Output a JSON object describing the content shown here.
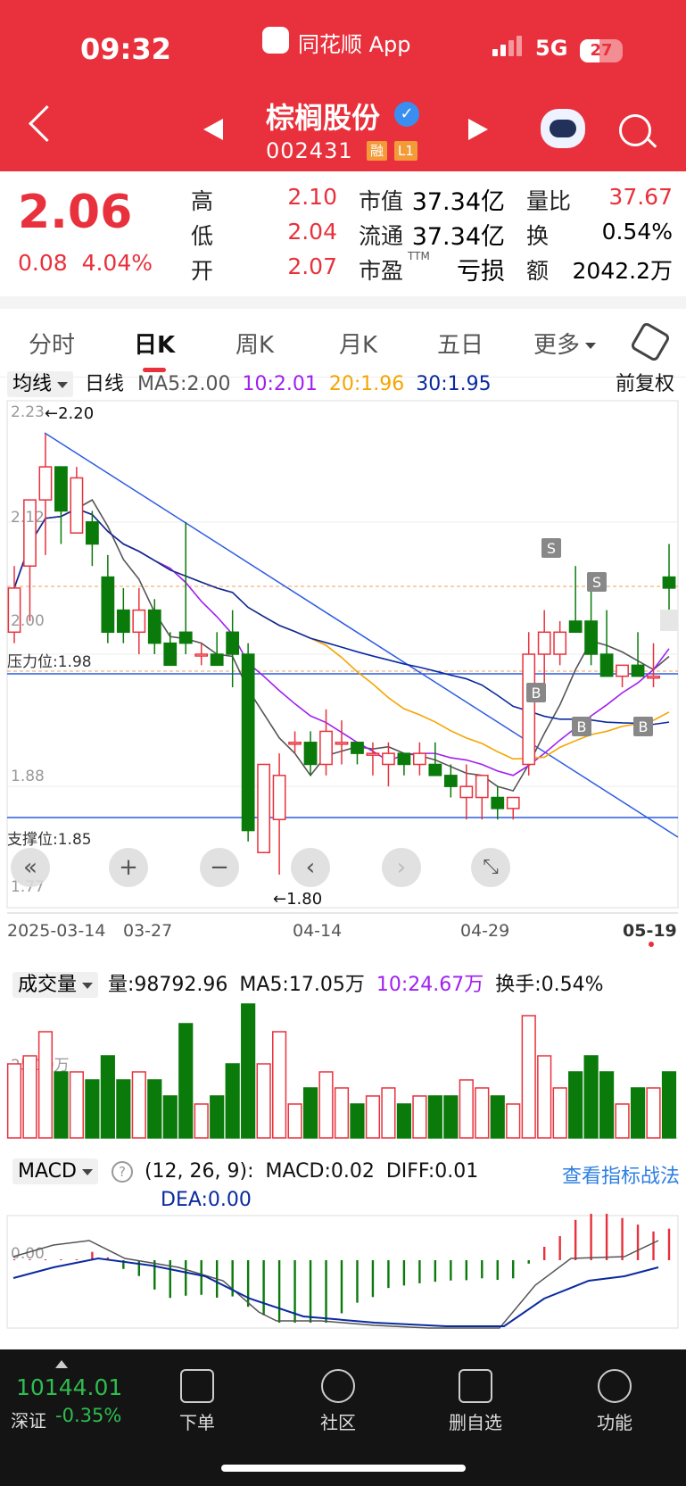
{
  "status_bar": {
    "time": "09:32",
    "app": "同花顺 App",
    "network": "5G",
    "battery": "27"
  },
  "header": {
    "stock_name": "棕榈股份",
    "code": "002431",
    "tag_margin": "融",
    "tag_level": "L1"
  },
  "quote": {
    "price": "2.06",
    "change": "0.08",
    "change_pct": "4.04%",
    "high_label": "高",
    "high": "2.10",
    "low_label": "低",
    "low": "2.04",
    "open_label": "开",
    "open": "2.07",
    "mktcap_label": "市值",
    "mktcap": "37.34亿",
    "float_label": "流通",
    "float": "37.34亿",
    "pe_label": "市盈",
    "pe_sup": "TTM",
    "pe": "亏损",
    "volratio_label": "量比",
    "volratio": "37.67",
    "turnover_label": "换",
    "turnover": "0.54%",
    "amount_label": "额",
    "amount": "2042.2万"
  },
  "tabs": [
    "分时",
    "日K",
    "周K",
    "月K",
    "五日",
    "更多"
  ],
  "ma_legend": {
    "selector": "均线",
    "period": "日线",
    "ma5": "MA5:2.00",
    "ma10": "10:2.01",
    "ma20": "20:1.96",
    "ma30": "30:1.95",
    "adjust": "前复权"
  },
  "kchart_labels": {
    "y_top": "2.23",
    "y_212": "2.12",
    "y_200": "2.00",
    "y_188": "1.88",
    "y_177": "1.77",
    "max_marker": "←2.20",
    "min_marker": "←1.80",
    "resistance": "压力位:1.98",
    "support": "支撑位:1.85",
    "dates": [
      "2025-03-14",
      "03-27",
      "04-14",
      "04-29",
      "05-19"
    ]
  },
  "chart_data": {
    "type": "candlestick",
    "ylim": [
      1.77,
      2.23
    ],
    "candles": [
      {
        "o": 2.02,
        "h": 2.08,
        "l": 2.01,
        "c": 2.06
      },
      {
        "o": 2.08,
        "h": 2.11,
        "l": 2.03,
        "c": 2.14
      },
      {
        "o": 2.14,
        "h": 2.2,
        "l": 2.09,
        "c": 2.17
      },
      {
        "o": 2.17,
        "h": 2.16,
        "l": 2.1,
        "c": 2.13
      },
      {
        "o": 2.11,
        "h": 2.17,
        "l": 2.11,
        "c": 2.16
      },
      {
        "o": 2.12,
        "h": 2.13,
        "l": 2.08,
        "c": 2.1
      },
      {
        "o": 2.07,
        "h": 2.09,
        "l": 2.01,
        "c": 2.02
      },
      {
        "o": 2.04,
        "h": 2.06,
        "l": 2.01,
        "c": 2.02
      },
      {
        "o": 2.02,
        "h": 2.06,
        "l": 2.0,
        "c": 2.04
      },
      {
        "o": 2.04,
        "h": 2.05,
        "l": 2.0,
        "c": 2.01
      },
      {
        "o": 2.01,
        "h": 2.02,
        "l": 1.99,
        "c": 1.99
      },
      {
        "o": 2.02,
        "h": 2.12,
        "l": 2.0,
        "c": 2.01
      },
      {
        "o": 2.0,
        "h": 2.01,
        "l": 1.99,
        "c": 2.0
      },
      {
        "o": 2.0,
        "h": 2.02,
        "l": 1.99,
        "c": 1.99
      },
      {
        "o": 2.02,
        "h": 2.04,
        "l": 1.97,
        "c": 2.0
      },
      {
        "o": 2.0,
        "h": 2.01,
        "l": 1.83,
        "c": 1.84
      },
      {
        "o": 1.82,
        "h": 1.89,
        "l": 1.82,
        "c": 1.9
      },
      {
        "o": 1.85,
        "h": 1.91,
        "l": 1.8,
        "c": 1.89
      },
      {
        "o": 1.92,
        "h": 1.93,
        "l": 1.91,
        "c": 1.92
      },
      {
        "o": 1.92,
        "h": 1.93,
        "l": 1.89,
        "c": 1.9
      },
      {
        "o": 1.9,
        "h": 1.95,
        "l": 1.89,
        "c": 1.93
      },
      {
        "o": 1.92,
        "h": 1.94,
        "l": 1.9,
        "c": 1.92
      },
      {
        "o": 1.92,
        "h": 1.92,
        "l": 1.9,
        "c": 1.91
      },
      {
        "o": 1.91,
        "h": 1.92,
        "l": 1.89,
        "c": 1.91
      },
      {
        "o": 1.9,
        "h": 1.92,
        "l": 1.88,
        "c": 1.91
      },
      {
        "o": 1.91,
        "h": 1.91,
        "l": 1.89,
        "c": 1.9
      },
      {
        "o": 1.9,
        "h": 1.92,
        "l": 1.89,
        "c": 1.91
      },
      {
        "o": 1.9,
        "h": 1.92,
        "l": 1.89,
        "c": 1.89
      },
      {
        "o": 1.89,
        "h": 1.9,
        "l": 1.87,
        "c": 1.88
      },
      {
        "o": 1.87,
        "h": 1.9,
        "l": 1.85,
        "c": 1.88
      },
      {
        "o": 1.87,
        "h": 1.89,
        "l": 1.85,
        "c": 1.89
      },
      {
        "o": 1.87,
        "h": 1.88,
        "l": 1.85,
        "c": 1.86
      },
      {
        "o": 1.86,
        "h": 1.87,
        "l": 1.85,
        "c": 1.87
      },
      {
        "o": 1.9,
        "h": 2.02,
        "l": 1.89,
        "c": 2.0
      },
      {
        "o": 2.0,
        "h": 2.04,
        "l": 1.96,
        "c": 2.02
      },
      {
        "o": 2.0,
        "h": 2.03,
        "l": 1.99,
        "c": 2.02
      },
      {
        "o": 2.03,
        "h": 2.08,
        "l": 2.02,
        "c": 2.02
      },
      {
        "o": 2.03,
        "h": 2.07,
        "l": 1.99,
        "c": 2.0
      },
      {
        "o": 2.0,
        "h": 2.04,
        "l": 1.98,
        "c": 1.98
      },
      {
        "o": 1.98,
        "h": 1.99,
        "l": 1.97,
        "c": 1.99
      },
      {
        "o": 1.99,
        "h": 2.02,
        "l": 1.98,
        "c": 1.98
      },
      {
        "o": 1.98,
        "h": 2.01,
        "l": 1.97,
        "c": 1.98
      },
      {
        "o": 2.07,
        "h": 2.1,
        "l": 2.04,
        "c": 2.06
      }
    ],
    "volume_axis_label": "25.19万",
    "macd_axis_label": "0.00"
  },
  "volume_legend": {
    "selector": "成交量",
    "vol": "量:98792.96",
    "ma5": "MA5:17.05万",
    "ma10": "10:24.67万",
    "turnover": "换手:0.54%"
  },
  "macd_legend": {
    "selector": "MACD",
    "params": "(12, 26, 9):",
    "macd": "MACD:0.02",
    "diff": "DIFF:0.01",
    "dea": "DEA:0.00",
    "link": "查看指标战法"
  },
  "bottom": {
    "index_value": "10144.01",
    "index_name": "深证",
    "index_change": "-0.35%",
    "items": [
      "下单",
      "社区",
      "删自选",
      "功能"
    ]
  },
  "colors": {
    "up": "#e8313c",
    "down": "#0a7a0a",
    "ma5": "#555555",
    "ma10": "#a020f0",
    "ma20": "#f5a500",
    "ma30": "#0a2aa0",
    "header": "#e8313c"
  }
}
